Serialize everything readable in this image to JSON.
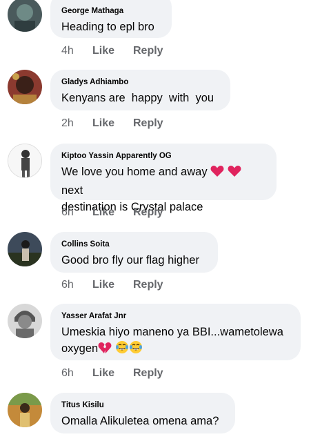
{
  "comments": [
    {
      "author": "George Mathaga",
      "text": "Heading to epl bro",
      "time": "4h",
      "like": "Like",
      "reply": "Reply"
    },
    {
      "author": "Gladys Adhiambo",
      "text": "Kenyans are  happy  with  you",
      "time": "2h",
      "like": "Like",
      "reply": "Reply"
    },
    {
      "author": "Kiptoo Yassin Apparently OG",
      "text_line1_a": "We love you home and away",
      "text_line1_b": "next",
      "text_line2": "destination is Crystal palace",
      "time": "6h",
      "like": "Like",
      "reply": "Reply"
    },
    {
      "author": "Collins Soita",
      "text": "Good bro fly our flag higher",
      "time": "6h",
      "like": "Like",
      "reply": "Reply"
    },
    {
      "author": "Yasser Arafat Jnr",
      "text_line1": "Umeskia hiyo maneno ya BBI...wametolewa",
      "text_line2": "oxygen",
      "time": "6h",
      "like": "Like",
      "reply": "Reply"
    },
    {
      "author": "Titus Kisilu",
      "text": "Omalla Alikuletea omena ama?"
    }
  ],
  "colors": {
    "bubble": "#f0f2f5",
    "meta": "#65676b",
    "heart": "#e0245e"
  },
  "icons": {
    "heart": "red-heart-icon",
    "broken_heart": "broken-heart-icon",
    "laugh": "tears-of-joy-icon"
  }
}
